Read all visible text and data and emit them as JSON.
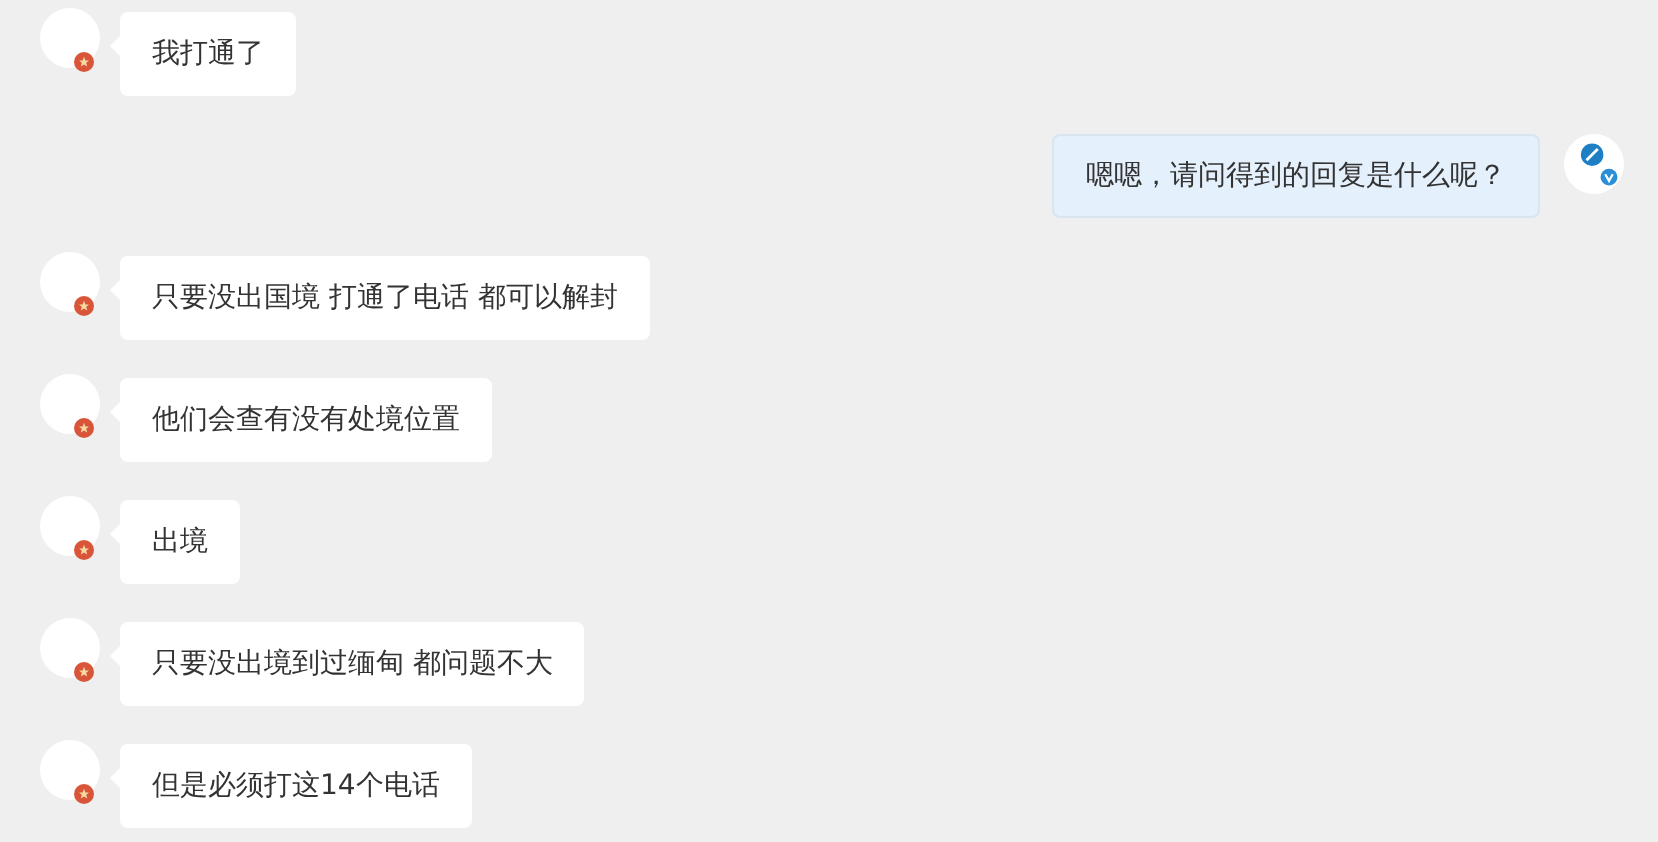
{
  "messages": [
    {
      "kind": "incoming",
      "text": "我打通了"
    },
    {
      "kind": "outgoing",
      "text": "嗯嗯，请问得到的回复是什么呢？"
    },
    {
      "kind": "incoming",
      "text": "只要没出国境 打通了电话 都可以解封"
    },
    {
      "kind": "incoming",
      "text": "他们会查有没有处境位置"
    },
    {
      "kind": "incoming",
      "text": "出境"
    },
    {
      "kind": "incoming",
      "text": "只要没出境到过缅甸 都问题不大"
    },
    {
      "kind": "incoming",
      "text": "但是必须打这14个电话"
    }
  ]
}
